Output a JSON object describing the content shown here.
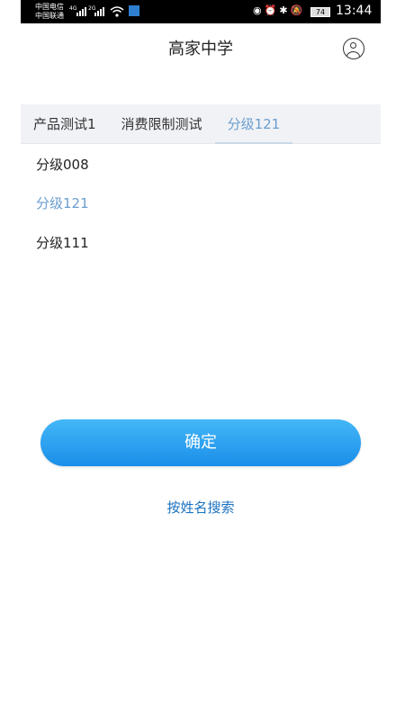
{
  "status_bar": {
    "carrier1": "中国电信",
    "carrier2": "中国联通",
    "net1": "4G",
    "net2": "2G",
    "battery": "74",
    "time": "13:44"
  },
  "header": {
    "title": "高家中学"
  },
  "tabs": [
    {
      "label": "产品测试1"
    },
    {
      "label": "消费限制测试"
    },
    {
      "label": "分级121",
      "active": true
    }
  ],
  "list": [
    {
      "label": "分级008"
    },
    {
      "label": "分级121",
      "selected": true
    },
    {
      "label": "分级111"
    }
  ],
  "confirm_label": "确定",
  "search_link": "按姓名搜索",
  "colors": {
    "accent": "#1b8ee9",
    "selected_text": "#6b9ecf",
    "link": "#1b72c0",
    "tab_bar": "#f1f2f6"
  },
  "icons": [
    "wifi-icon",
    "app-icon",
    "eye-icon",
    "alarm-icon",
    "bluetooth-icon",
    "mute-icon",
    "battery-icon",
    "user-icon"
  ]
}
